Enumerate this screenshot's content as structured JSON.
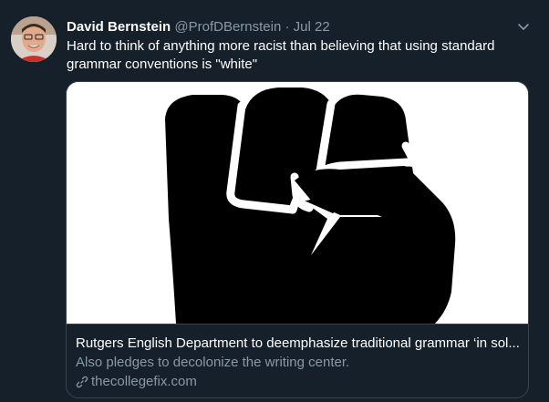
{
  "tweet": {
    "author_name": "David Bernstein",
    "handle": "@ProfDBernstein",
    "separator": "·",
    "date": "Jul 22",
    "text": "Hard to think of anything more racist than believing that using standard grammar conventions is \"white\""
  },
  "card": {
    "title": "Rutgers English Department to deemphasize traditional grammar ‘in sol...",
    "description": "Also pledges to decolonize the writing center.",
    "domain": "thecollegefix.com",
    "image_icon": "raised-fist-image"
  },
  "icons": {
    "menu": "chevron-down-icon",
    "link": "link-icon"
  },
  "colors": {
    "background": "#15202b",
    "secondary_text": "#8899a6",
    "border": "#38444d"
  }
}
